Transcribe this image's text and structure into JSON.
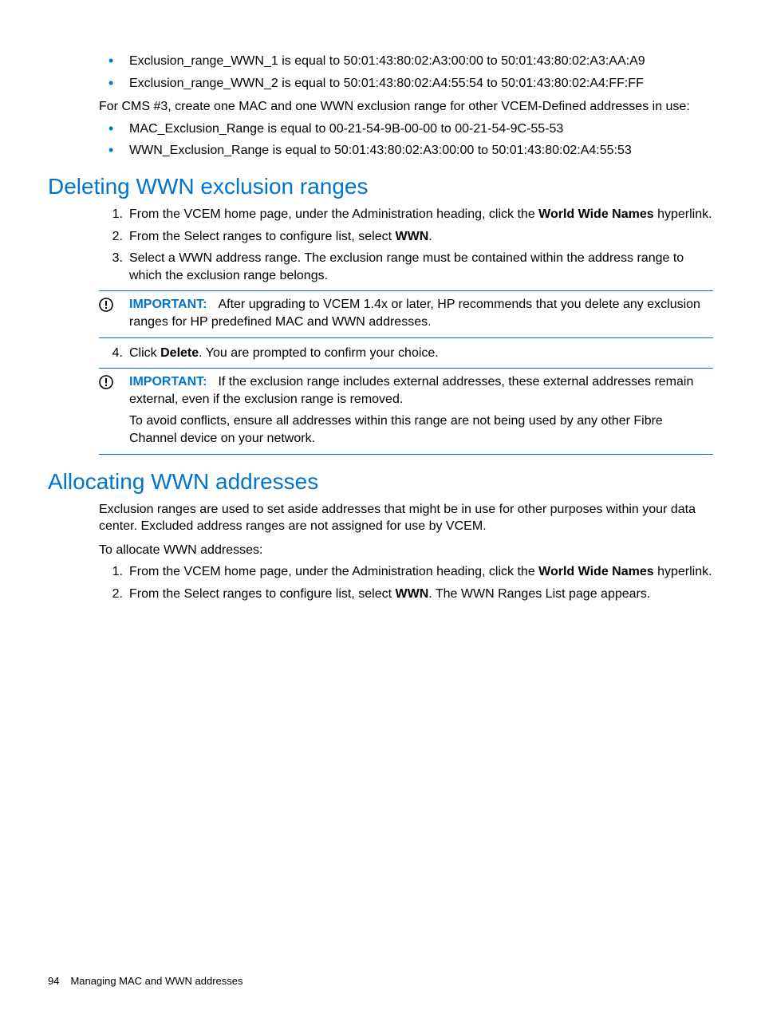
{
  "top_bullets": [
    "Exclusion_range_WWN_1 is equal to 50:01:43:80:02:A3:00:00 to 50:01:43:80:02:A3:AA:A9",
    "Exclusion_range_WWN_2 is equal to 50:01:43:80:02:A4:55:54 to 50:01:43:80:02:A4:FF:FF"
  ],
  "cms3_intro": "For CMS #3, create one MAC and one WWN exclusion range for other VCEM-Defined addresses in use:",
  "cms3_bullets": [
    "MAC_Exclusion_Range is equal to 00-21-54-9B-00-00 to 00-21-54-9C-55-53",
    "WWN_Exclusion_Range is equal to 50:01:43:80:02:A3:00:00 to 50:01:43:80:02:A4:55:53"
  ],
  "section1_heading": "Deleting WWN exclusion ranges",
  "section1_steps": {
    "s1_pre": "From the VCEM home page, under the Administration heading, click the ",
    "s1_bold": "World Wide Names",
    "s1_post": " hyperlink.",
    "s2_pre": "From the Select ranges to configure list, select ",
    "s2_bold": "WWN",
    "s2_post": ".",
    "s3": "Select a WWN address range. The exclusion range must be contained within the address range to which the exclusion range belongs.",
    "s4_pre": "Click ",
    "s4_bold": "Delete",
    "s4_post": ". You are prompted to confirm your choice."
  },
  "important_label": "IMPORTANT:",
  "note1_text": "After upgrading to VCEM 1.4x or later, HP recommends that you delete any exclusion ranges for HP predefined MAC and WWN addresses.",
  "note2_text": "If the exclusion range includes external addresses, these external addresses remain external, even if the exclusion range is removed.",
  "note2_extra": "To avoid conflicts, ensure all addresses within this range are not being used by any other Fibre Channel device on your network.",
  "section2_heading": "Allocating WWN addresses",
  "section2_intro1": "Exclusion ranges are used to set aside addresses that might be in use for other purposes within your data center. Excluded address ranges are not assigned for use by VCEM.",
  "section2_intro2": "To allocate WWN addresses:",
  "section2_steps": {
    "s1_pre": "From the VCEM home page, under the Administration heading, click the ",
    "s1_bold": "World Wide Names",
    "s1_post": " hyperlink.",
    "s2_pre": "From the Select ranges to configure list, select ",
    "s2_bold": "WWN",
    "s2_post": ". The WWN Ranges List page appears."
  },
  "footer": {
    "page_number": "94",
    "title": "Managing MAC and WWN addresses"
  }
}
